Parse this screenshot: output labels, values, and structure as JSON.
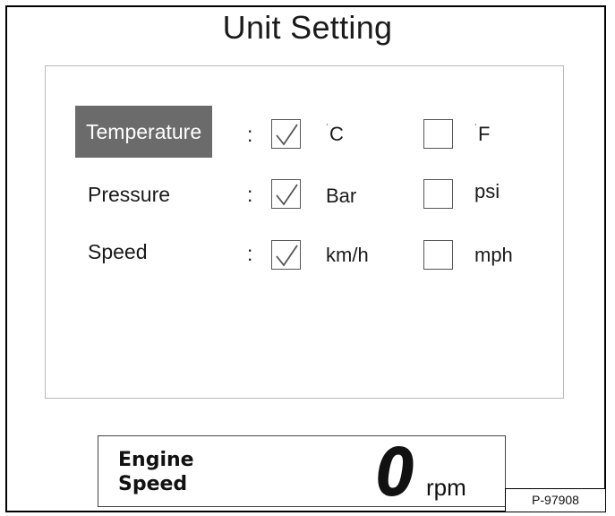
{
  "screen": {
    "title": "Unit Setting"
  },
  "settings": [
    {
      "label": "Temperature",
      "selected": true,
      "separator": ":",
      "options": [
        {
          "label": "C",
          "checked": true,
          "degree_mark": true
        },
        {
          "label": "F",
          "checked": false,
          "degree_mark": true
        }
      ]
    },
    {
      "label": "Pressure",
      "selected": false,
      "separator": ":",
      "options": [
        {
          "label": "Bar",
          "checked": true
        },
        {
          "label": "psi",
          "checked": false
        }
      ]
    },
    {
      "label": "Speed",
      "selected": false,
      "separator": ":",
      "options": [
        {
          "label": "km/h",
          "checked": true
        },
        {
          "label": "mph",
          "checked": false
        }
      ]
    }
  ],
  "engine_speed": {
    "label_line1": "Engine",
    "label_line2": "Speed",
    "value": "0",
    "unit": "rpm"
  },
  "figure_id": "P-97908",
  "colors": {
    "selection_background": "#6b6b6b",
    "checkmark": "#555555"
  },
  "icons": {
    "checked": "checkmark-icon",
    "degree": "degree-icon"
  }
}
